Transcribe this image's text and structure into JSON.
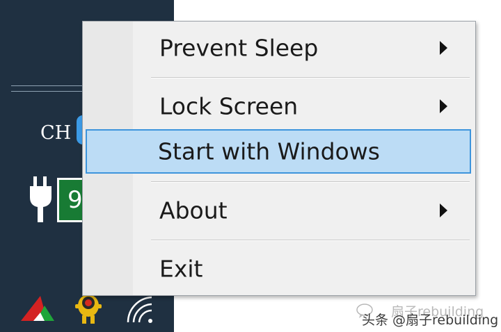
{
  "taskbar": {
    "ime_indicator": "CH",
    "green_tray_glyph": "9",
    "icons": {
      "power": "power-plug-icon",
      "red_app": "red-green-triangle-icon",
      "yellow_app": "yellow-creature-icon",
      "wifi": "wifi-icon"
    }
  },
  "context_menu": {
    "items": [
      {
        "label": "Prevent Sleep",
        "has_submenu": true,
        "highlighted": false
      },
      {
        "label": "Lock Screen",
        "has_submenu": true,
        "highlighted": false
      },
      {
        "label": "Start with Windows",
        "has_submenu": false,
        "highlighted": true
      },
      {
        "label": "About",
        "has_submenu": true,
        "highlighted": false
      },
      {
        "label": "Exit",
        "has_submenu": false,
        "highlighted": false
      }
    ]
  },
  "watermark": {
    "text": "头条 @扇子rebuilding",
    "ghost_text": "扇子rebuilding",
    "icon": "chat-bubble-icon"
  },
  "colors": {
    "taskbar_bg": "#1f3041",
    "menu_bg": "#f0f0f0",
    "highlight_fill": "#bcdcf5",
    "highlight_border": "#3d94dc",
    "tray_green": "#187b34"
  }
}
